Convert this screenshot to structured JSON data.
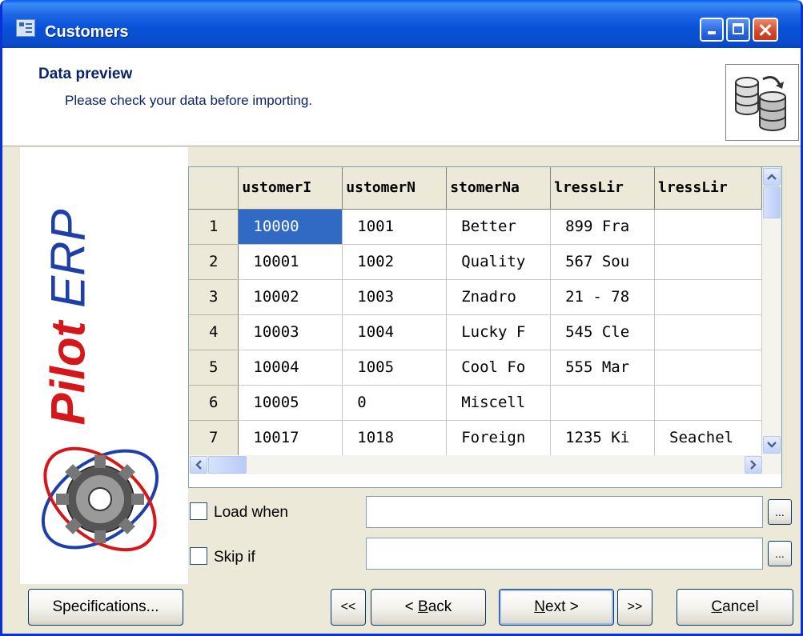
{
  "window": {
    "title": "Customers"
  },
  "header": {
    "title": "Data preview",
    "subtitle": "Please check your data before importing."
  },
  "brand": {
    "pilot": "Pilot",
    "erp": "ERP"
  },
  "grid": {
    "columns": [
      "ustomerI",
      "ustomerN",
      "stomerNa",
      "lressLir",
      "lressLir"
    ],
    "rows": [
      {
        "num": "1",
        "cells": [
          "10000",
          "1001",
          "Better",
          "899 Fra",
          ""
        ]
      },
      {
        "num": "2",
        "cells": [
          "10001",
          "1002",
          "Quality",
          "567 Sou",
          ""
        ]
      },
      {
        "num": "3",
        "cells": [
          "10002",
          "1003",
          "Znadro",
          "21 - 78",
          ""
        ]
      },
      {
        "num": "4",
        "cells": [
          "10003",
          "1004",
          "Lucky F",
          "545 Cle",
          ""
        ]
      },
      {
        "num": "5",
        "cells": [
          "10004",
          "1005",
          "Cool Fo",
          "555 Mar",
          ""
        ]
      },
      {
        "num": "6",
        "cells": [
          "10005",
          "0",
          "Miscell",
          "",
          ""
        ]
      },
      {
        "num": "7",
        "cells": [
          "10017",
          "1018",
          "Foreign",
          "1235 Ki",
          "Seachel"
        ]
      }
    ]
  },
  "filters": {
    "load_when": {
      "label": "Load when",
      "value": "",
      "button": "..."
    },
    "skip_if": {
      "label": "Skip if",
      "value": "",
      "button": "..."
    }
  },
  "buttons": {
    "specifications": "Specifications...",
    "first": "<<",
    "back_prefix": "< ",
    "back_key": "B",
    "back_rest": "ack",
    "next_key": "N",
    "next_rest": "ext >",
    "last": ">>",
    "cancel_key": "C",
    "cancel_rest": "ancel"
  },
  "colors": {
    "selection": "#316AC5",
    "titlebar": "#0A4CCB",
    "brand_red": "#D4171B",
    "brand_blue": "#1E3FA8"
  }
}
